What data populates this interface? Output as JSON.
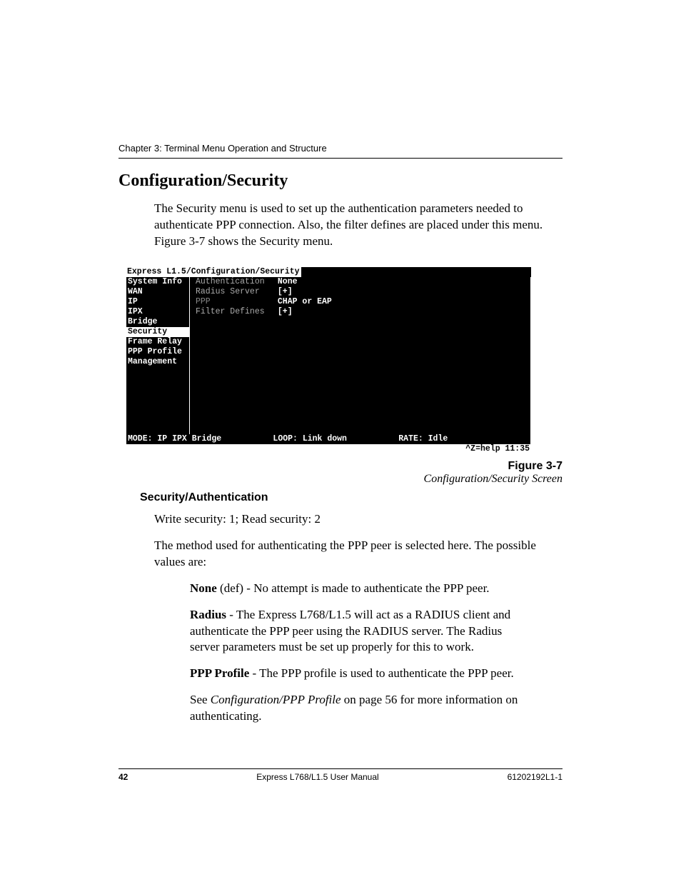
{
  "chapter": "Chapter 3: Terminal Menu Operation and Structure",
  "section_title": "Configuration/Security",
  "intro": "The Security menu is used to set up the authentication parameters needed to authenticate PPP connection.  Also, the filter defines are placed under this menu. Figure 3-7 shows the Security menu.",
  "terminal": {
    "title": "Express L1.5/Configuration/Security",
    "menu": [
      "System Info",
      "WAN",
      "IP",
      "IPX",
      "Bridge",
      "Security",
      "Frame Relay",
      "PPP Profile",
      "Management"
    ],
    "selected_menu": "Security",
    "fields": [
      {
        "label": "Authentication",
        "value": "None"
      },
      {
        "label": "Radius Server",
        "value": "[+]"
      },
      {
        "label": "PPP",
        "value": "CHAP or EAP"
      },
      {
        "label": "Filter Defines",
        "value": "[+]"
      }
    ],
    "status": {
      "mode": "MODE: IP IPX Bridge",
      "loop": "LOOP: Link down",
      "rate": "RATE: Idle"
    },
    "help": "^Z=help 11:35"
  },
  "figure": {
    "number": "Figure 3-7",
    "caption": "Configuration/Security Screen"
  },
  "subhead": "Security/Authentication",
  "sec_line": "Write security: 1; Read security: 2",
  "sec_body": "The method used for authenticating the PPP peer is selected here.  The possible values are:",
  "defs": {
    "none": {
      "term": "None",
      "rest": " (def) - No attempt is made to authenticate the PPP peer."
    },
    "radius": {
      "term": "Radius",
      "rest": " - The Express L768/L1.5 will act as a RADIUS client and authenticate the PPP peer using the RADIUS server.  The Radius server parameters must be set up properly for this to work."
    },
    "ppp": {
      "term": "PPP Profile",
      "rest": " - The PPP profile is used to authenticate the PPP peer."
    },
    "see_pre": "See ",
    "see_ital": "Configuration/PPP Profile",
    "see_post": " on page 56 for more information on authenticating."
  },
  "footer": {
    "page": "42",
    "center": "Express L768/L1.5 User Manual",
    "right": "61202192L1-1"
  }
}
